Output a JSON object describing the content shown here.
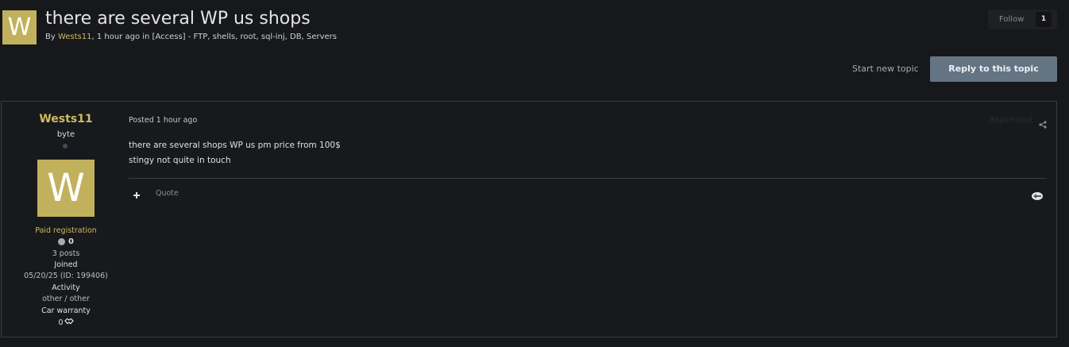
{
  "header": {
    "avatar_letter": "W",
    "title": "there are several WP us shops",
    "by_prefix": "By ",
    "author": "Wests11",
    "meta_suffix": ", 1 hour ago in [Access] - FTP, shells, root, sql-inj, DB, Servers",
    "follow_label": "Follow",
    "follow_count": "1",
    "start_topic_label": "Start new topic",
    "reply_label": "Reply to this topic"
  },
  "post": {
    "author": {
      "name": "Wests11",
      "rank": "byte",
      "avatar_letter": "W",
      "group": "Paid registration",
      "reputation": "0",
      "posts": "3 posts",
      "joined_label": "Joined",
      "joined_value": "05/20/25 (ID: 199406)",
      "activity_label": "Activity",
      "activity_value": "other / other",
      "warranty_label": "Car warranty",
      "warranty_value": "0"
    },
    "date": "Posted 1 hour ago",
    "report_label": "Report post",
    "body_lines": [
      "there are several shops WP us pm price from 100$",
      "stingy not quite in touch"
    ],
    "quote_label": "Quote"
  },
  "colors": {
    "background": "#17181c",
    "accent_gold": "#cdbb5f",
    "avatar_bg": "#c2b15c",
    "reply_button": "#657483"
  },
  "icons": {
    "share": "share-icon",
    "plus": "plus-icon",
    "reaction": "reaction-icon",
    "handshake": "handshake-icon"
  }
}
